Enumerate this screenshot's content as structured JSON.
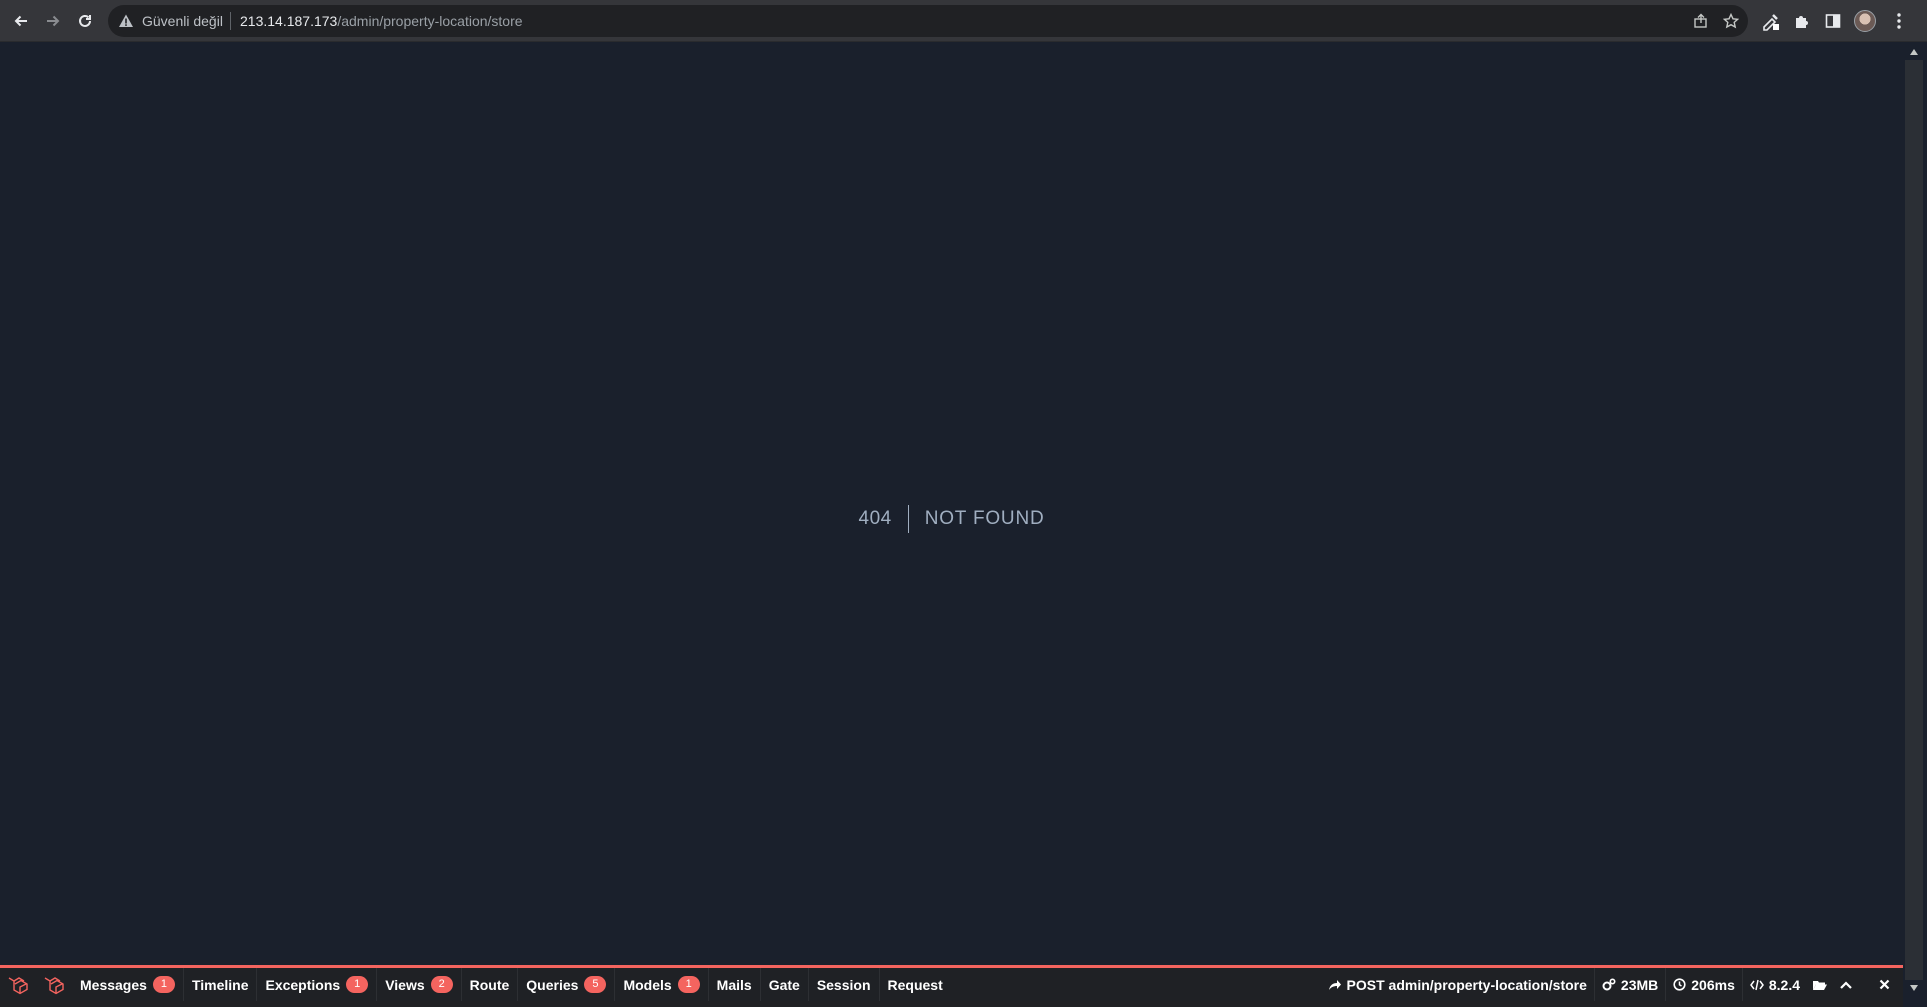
{
  "browser": {
    "security_label": "Güvenli değil",
    "url_host": "213.14.187.173",
    "url_path": "/admin/property-location/store"
  },
  "error": {
    "code": "404",
    "message": "NOT FOUND"
  },
  "debugbar": {
    "accent_color": "#f4645f",
    "tabs": [
      {
        "label": "Messages",
        "badge": "1"
      },
      {
        "label": "Timeline",
        "badge": ""
      },
      {
        "label": "Exceptions",
        "badge": "1"
      },
      {
        "label": "Views",
        "badge": "2"
      },
      {
        "label": "Route",
        "badge": ""
      },
      {
        "label": "Queries",
        "badge": "5"
      },
      {
        "label": "Models",
        "badge": "1"
      },
      {
        "label": "Mails",
        "badge": ""
      },
      {
        "label": "Gate",
        "badge": ""
      },
      {
        "label": "Session",
        "badge": ""
      },
      {
        "label": "Request",
        "badge": ""
      }
    ],
    "request": "POST admin/property-location/store",
    "memory": "23MB",
    "duration": "206ms",
    "php_version": "8.2.4"
  }
}
